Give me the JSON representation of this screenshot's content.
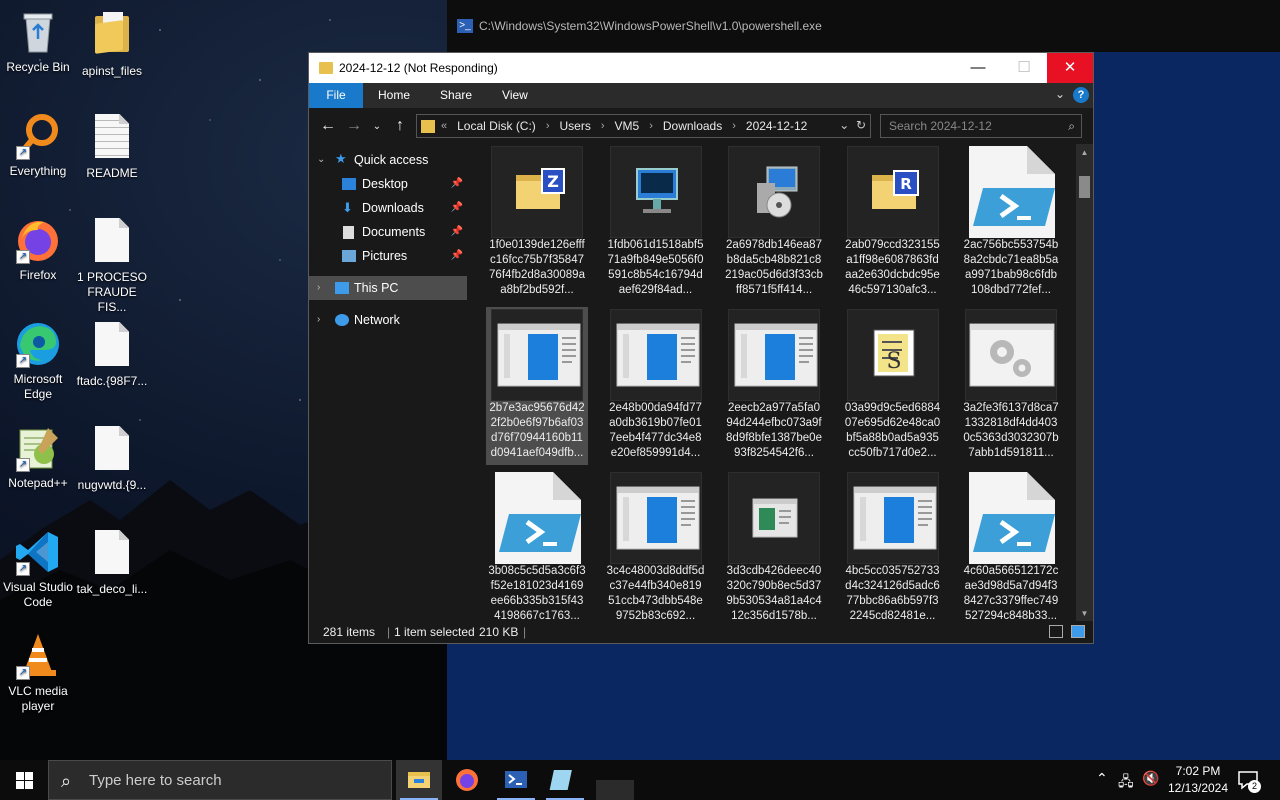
{
  "desktop": {
    "icons": [
      {
        "label": "Recycle Bin"
      },
      {
        "label": "apinst_files"
      },
      {
        "label": "Everything"
      },
      {
        "label": "README"
      },
      {
        "label": "Firefox"
      },
      {
        "label": "1 PROCESO FRAUDE FIS..."
      },
      {
        "label": "Microsoft Edge"
      },
      {
        "label": "ftadc.{98F7..."
      },
      {
        "label": "Notepad++"
      },
      {
        "label": "nugvwtd.{9..."
      },
      {
        "label": "Visual Studio Code"
      },
      {
        "label": "tak_deco_li..."
      },
      {
        "label": "VLC media player"
      }
    ]
  },
  "powershell": {
    "title": "C:\\Windows\\System32\\WindowsPowerShell\\v1.0\\powershell.exe"
  },
  "explorer": {
    "title": "2024-12-12 (Not Responding)",
    "controls": {
      "minimize": "—",
      "maximize": "☐",
      "close": "✕"
    },
    "ribbon_tabs": [
      "File",
      "Home",
      "Share",
      "View"
    ],
    "address": {
      "prefix": "«",
      "crumbs": [
        "Local Disk (C:)",
        "Users",
        "VM5",
        "Downloads",
        "2024-12-12"
      ]
    },
    "search_placeholder": "Search 2024-12-12",
    "nav_pane": {
      "quick_access": "Quick access",
      "pinned": [
        "Desktop",
        "Downloads",
        "Documents",
        "Pictures"
      ],
      "this_pc": "This PC",
      "network": "Network"
    },
    "files": [
      {
        "name": "1f0e0139de126efffc16fcc75b7f3584776f4fb2d8a30089aa8bf2bd592f...",
        "icon": "folder-zip-icon"
      },
      {
        "name": "1fdb061d1518abf571a9fb849e5056f0591c8b54c16794daef629f84ad...",
        "icon": "monitor-app-icon"
      },
      {
        "name": "2a6978db146ea87b8da5cb48b821c8219ac05d6d3f33cbff8571f5ff414...",
        "icon": "installer-icon"
      },
      {
        "name": "2ab079ccd323155a1ff98e6087863fdaa2e630dcbdc95e46c597130afc3...",
        "icon": "folder-rar-icon"
      },
      {
        "name": "2ac756bc553754b8a2cbdc71ea8b5aa9971bab98c6fdb108dbd772fef...",
        "icon": "powershell-script-icon"
      },
      {
        "name": "2b7e3ac95676d422f2b0e6f97b6af03d76f70944160b11d0941aef049dfb...",
        "icon": "app-window-icon"
      },
      {
        "name": "2e48b00da94fd77a0db3619b07fe017eeb4f477dc34e8e20ef859991d4...",
        "icon": "app-window-icon"
      },
      {
        "name": "2eecb2a977a5fa094d244efbc073a9f8d9f8bfe1387be0e93f8254542f6...",
        "icon": "app-window-icon"
      },
      {
        "name": "03a99d9c5ed688407e695d62e48ca0bf5a88b0ad5a935cc50fb717d0e2...",
        "icon": "script-scroll-icon"
      },
      {
        "name": "3a2fe3f6137d8ca71332818df4dd4030c5363d3032307b7abb1d591811...",
        "icon": "gears-icon"
      },
      {
        "name": "3b08c5c5d5a3c6f3f52e181023d4169ee66b335b315f434198667c1763...",
        "icon": "powershell-script-icon"
      },
      {
        "name": "3c4c48003d8ddf5dc37e44fb340e81951ccb473dbb548e9752b83c692...",
        "icon": "app-window-icon"
      },
      {
        "name": "3d3cdb426deec40320c790b8ec5d379b530534a81a4c412c356d1578b...",
        "icon": "small-window-icon"
      },
      {
        "name": "4bc5cc035752733d4c324126d5adc677bbc86a6b597f32245cd82481e...",
        "icon": "app-window-icon"
      },
      {
        "name": "4c60a566512172cae3d98d5a7d94f38427c3379ffec749527294c848b33...",
        "icon": "powershell-script-icon"
      }
    ],
    "selected_index": 5,
    "status": {
      "count": "281 items",
      "selection": "1 item selected",
      "size": "210 KB"
    }
  },
  "taskbar": {
    "search_placeholder": "Type here to search",
    "time": "7:02 PM",
    "date": "12/13/2024",
    "notifications": "2"
  },
  "colors": {
    "accent": "#1979ca",
    "close_red": "#e81123",
    "ps_blue": "#0a2761"
  }
}
